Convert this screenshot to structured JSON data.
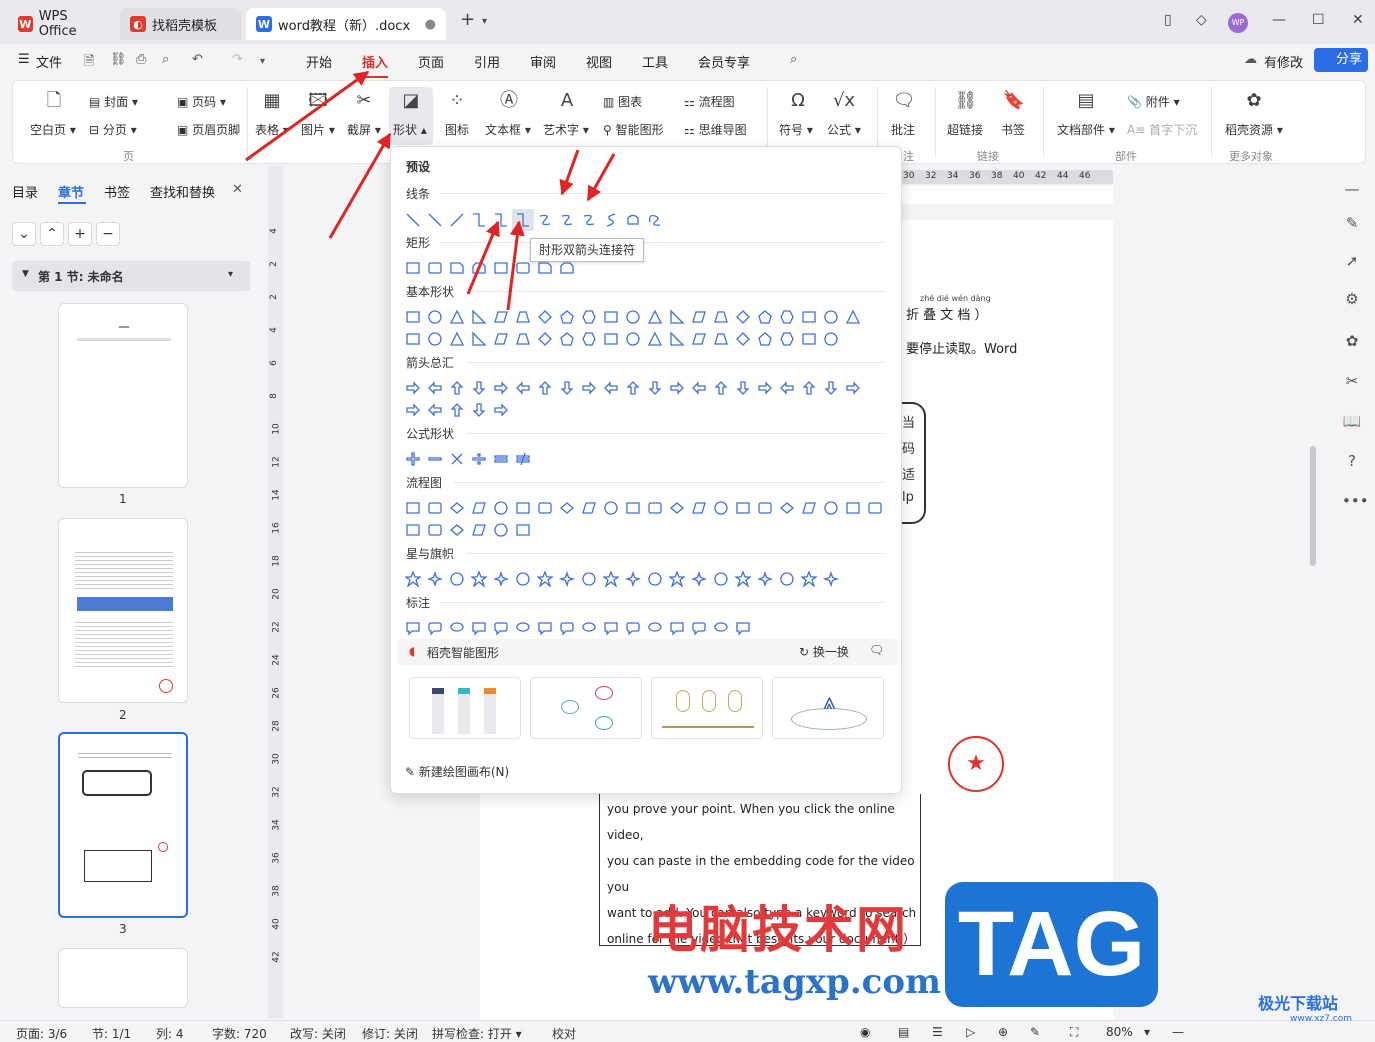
{
  "titlebar": {
    "tabs": [
      {
        "label": "WPS Office"
      },
      {
        "label": "找稻壳模板"
      },
      {
        "label": "word教程（新）.docx"
      }
    ],
    "user_avatar": "WP"
  },
  "menubar": {
    "file": "文件",
    "items": [
      "开始",
      "插入",
      "页面",
      "引用",
      "审阅",
      "视图",
      "工具",
      "会员专享"
    ],
    "active": "插入",
    "modified": "有修改",
    "share": "分享"
  },
  "ribbon": {
    "cover": "封面",
    "pagenum": "页码",
    "blank": "空白页",
    "pagebreak": "分页",
    "header_footer": "页眉页脚",
    "group_page": "页",
    "table": "表格",
    "picture": "图片",
    "screenshot": "截屏",
    "shape": "形状",
    "icon": "图标",
    "textbox": "文本框",
    "arttext": "艺术字",
    "chart": "图表",
    "smartart": "智能图形",
    "flowchart": "流程图",
    "mindmap": "思维导图",
    "symbol": "符号",
    "formula": "公式",
    "comment": "批注",
    "group_comment": "注",
    "hyperlink": "超链接",
    "bookmark": "书签",
    "group_link": "链接",
    "attachment": "附件",
    "docpart": "文档部件",
    "dropcap": "首字下沉",
    "group_part": "部件",
    "daoke": "稻壳资源",
    "group_more": "更多对象"
  },
  "leftpanel": {
    "tabs": [
      "目录",
      "章节",
      "书签",
      "查找和替换"
    ],
    "active_tab": "章节",
    "section_title": "第 1 节: 未命名",
    "pages": [
      "1",
      "2",
      "3"
    ]
  },
  "shapes_panel": {
    "preset": "预设",
    "categories": [
      "线条",
      "矩形",
      "基本形状",
      "箭头总汇",
      "公式形状",
      "流程图",
      "星与旗帜",
      "标注"
    ],
    "tooltip": "肘形双箭头连接符",
    "ai_title": "稻壳智能图形",
    "swap": "换一换",
    "new_canvas": "新建绘图画布(N)"
  },
  "document": {
    "ruby": "zhé dié wén dàng",
    "line1": "折 叠 文 档 ）",
    "line2": "要停止读取。Word",
    "side_chars": [
      "当",
      "码",
      "适",
      "lp"
    ],
    "body": [
      "you prove your point. When you click the online video,",
      "you can paste in the embedding code for the video you",
      "want to add. You can also type a keyword to search",
      "online for the video that best fits your document.）"
    ],
    "ruler": [
      "30",
      "32",
      "34",
      "36",
      "38",
      "40",
      "42",
      "44",
      "46"
    ],
    "vruler": [
      "4",
      "2",
      "2",
      "4",
      "6",
      "8",
      "10",
      "12",
      "14",
      "16",
      "18",
      "20",
      "22",
      "24",
      "26",
      "28",
      "30",
      "32",
      "34",
      "36",
      "38",
      "40",
      "42"
    ]
  },
  "statusbar": {
    "page": "页面: 3/6",
    "section": "节: 1/1",
    "column": "列: 4",
    "words": "字数: 720",
    "rewrite": "改写: 关闭",
    "revise": "修订: 关闭",
    "spell": "拼写检查: 打开",
    "proof": "校对",
    "zoom": "80%"
  },
  "watermark": {
    "cn": "电脑技术网",
    "url": "www.tagxp.com",
    "tag": "TAG",
    "site": "极光下载站",
    "site_url": "www.xz7.com"
  },
  "colors": {
    "accent": "#d9352b",
    "blue": "#2b6de6",
    "shape": "#3d72d6"
  }
}
